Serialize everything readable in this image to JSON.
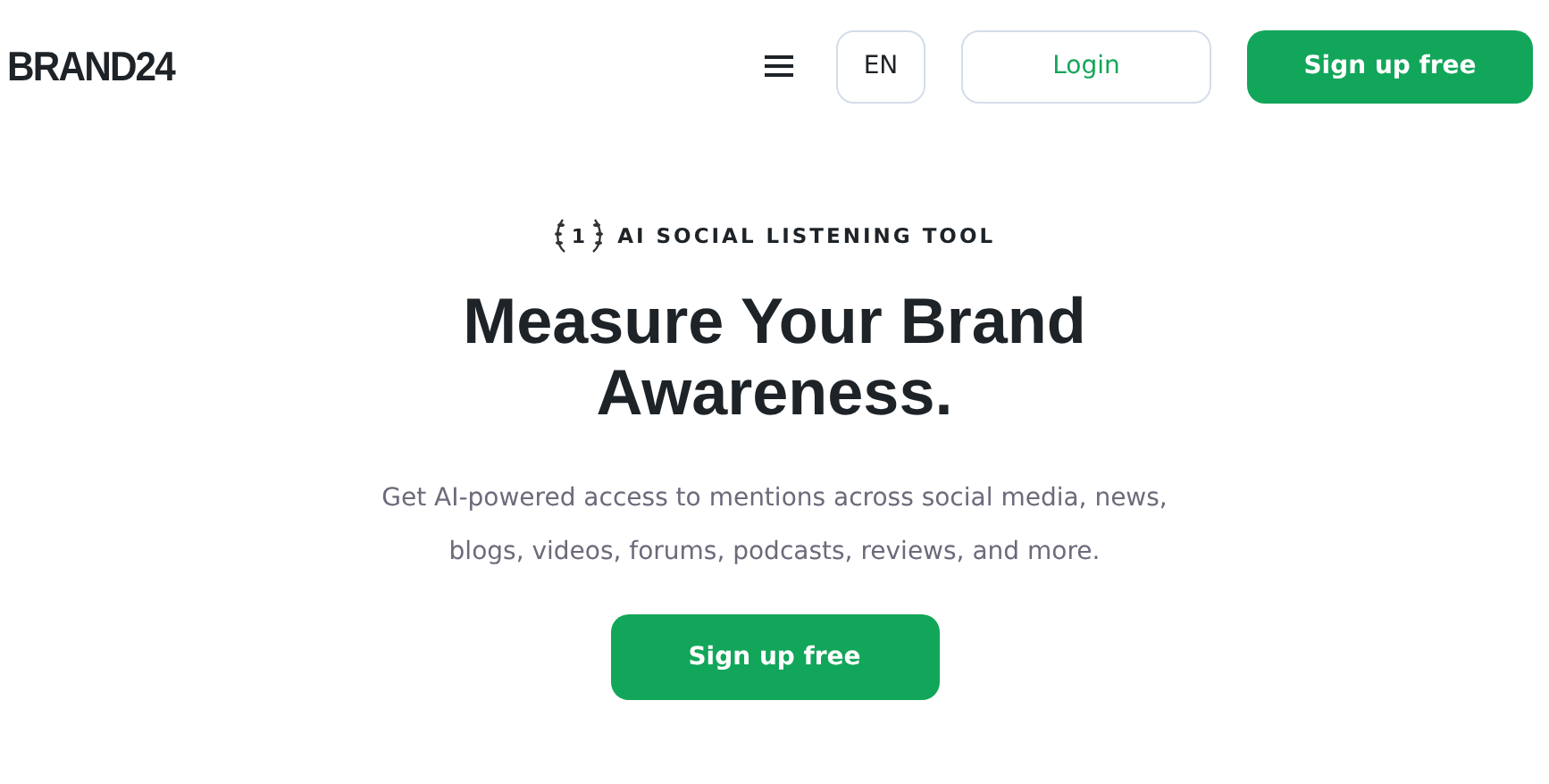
{
  "header": {
    "logo": "BRAND24",
    "language": "EN",
    "login": "Login",
    "signup": "Sign up free"
  },
  "hero": {
    "badge_number": "1",
    "badge": "AI SOCIAL LISTENING TOOL",
    "title": "Measure Your Brand Awareness.",
    "description": "Get AI-powered access to mentions across social media, news, blogs, videos, forums, podcasts, reviews, and more.",
    "cta": "Sign up free"
  }
}
